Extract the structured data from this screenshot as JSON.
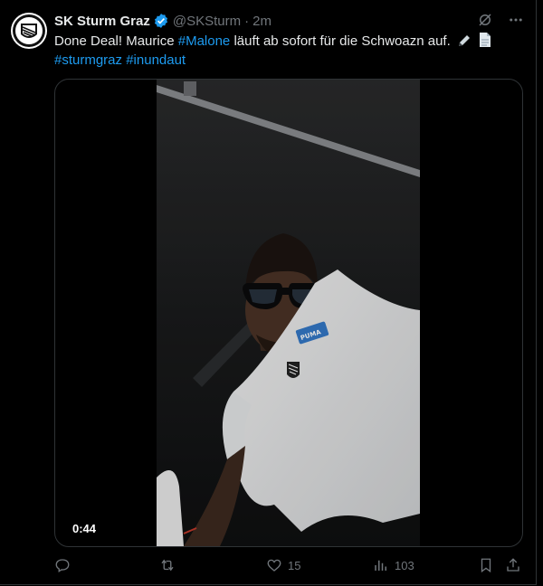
{
  "post": {
    "author_name": "SK Sturm Graz",
    "author_handle": "@SKSturm",
    "separator": "·",
    "time": "2m",
    "text_part1": "Done Deal! Maurice ",
    "hashtag_malone": "#Malone",
    "text_part2": " läuft ab sofort für die Schwoazn auf.",
    "hashtag_sturmgraz": "#sturmgraz",
    "hashtag_inundaut": "#inundaut",
    "emojis": [
      "pen-icon",
      "page-icon"
    ]
  },
  "media": {
    "duration": "0:44",
    "tshirt_label": "PUMA"
  },
  "actions": {
    "reply_count": "",
    "retweet_count": "",
    "like_count": "15",
    "views_count": "103"
  },
  "colors": {
    "background": "#000000",
    "text": "#e7e9ea",
    "muted": "#71767b",
    "accent": "#1d9bf0",
    "border": "#2f3336"
  }
}
